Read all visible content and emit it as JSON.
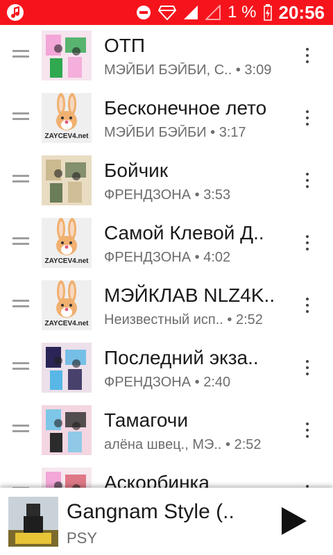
{
  "status_bar": {
    "battery": "1 %",
    "time": "20:56"
  },
  "tracks": [
    {
      "title": "ОТП",
      "artist": "МЭЙБИ БЭЙБИ, С..",
      "duration": "• 3:09",
      "cover": "art"
    },
    {
      "title": "Бесконечное лето",
      "artist": "МЭЙБИ БЭЙБИ",
      "duration": "• 3:17",
      "cover": "zaycev"
    },
    {
      "title": "Бойчик",
      "artist": "ФРЕНДЗОНА",
      "duration": "• 3:53",
      "cover": "art"
    },
    {
      "title": "Самой Клевой Д..",
      "artist": "ФРЕНДЗОНА",
      "duration": "• 4:02",
      "cover": "zaycev"
    },
    {
      "title": "МЭЙКЛАВ NLZ4K..",
      "artist": "Неизвестный исп..",
      "duration": "• 2:52",
      "cover": "zaycev"
    },
    {
      "title": "Последний экза..",
      "artist": "ФРЕНДЗОНА",
      "duration": "• 2:40",
      "cover": "art"
    },
    {
      "title": "Тамагочи",
      "artist": "алёна швец., МЭ..",
      "duration": "• 2:52",
      "cover": "art"
    },
    {
      "title": "Аскорбинка",
      "artist": "",
      "duration": "",
      "cover": "art"
    }
  ],
  "zaycev_label": "ZAYCEV4.net",
  "now_playing": {
    "title": "Gangnam Style (..",
    "artist": "PSY"
  }
}
